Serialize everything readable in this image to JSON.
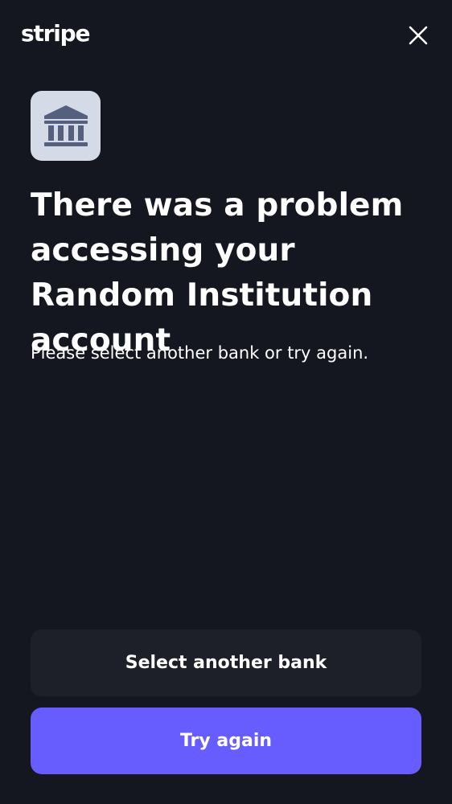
{
  "header": {
    "logo_text": "stripe",
    "close_icon": "close-icon"
  },
  "institution": {
    "icon": "bank-icon",
    "tile_color": "#d5dbe6",
    "icon_color": "#55607f"
  },
  "error": {
    "title": "There was a problem accessing your Random Institution account",
    "message": "Please select another bank or try again."
  },
  "actions": {
    "secondary_label": "Select another bank",
    "primary_label": "Try again"
  },
  "colors": {
    "background": "#14171f",
    "primary_button": "#675dff",
    "secondary_button": "#1d2029",
    "text": "#ffffff"
  }
}
